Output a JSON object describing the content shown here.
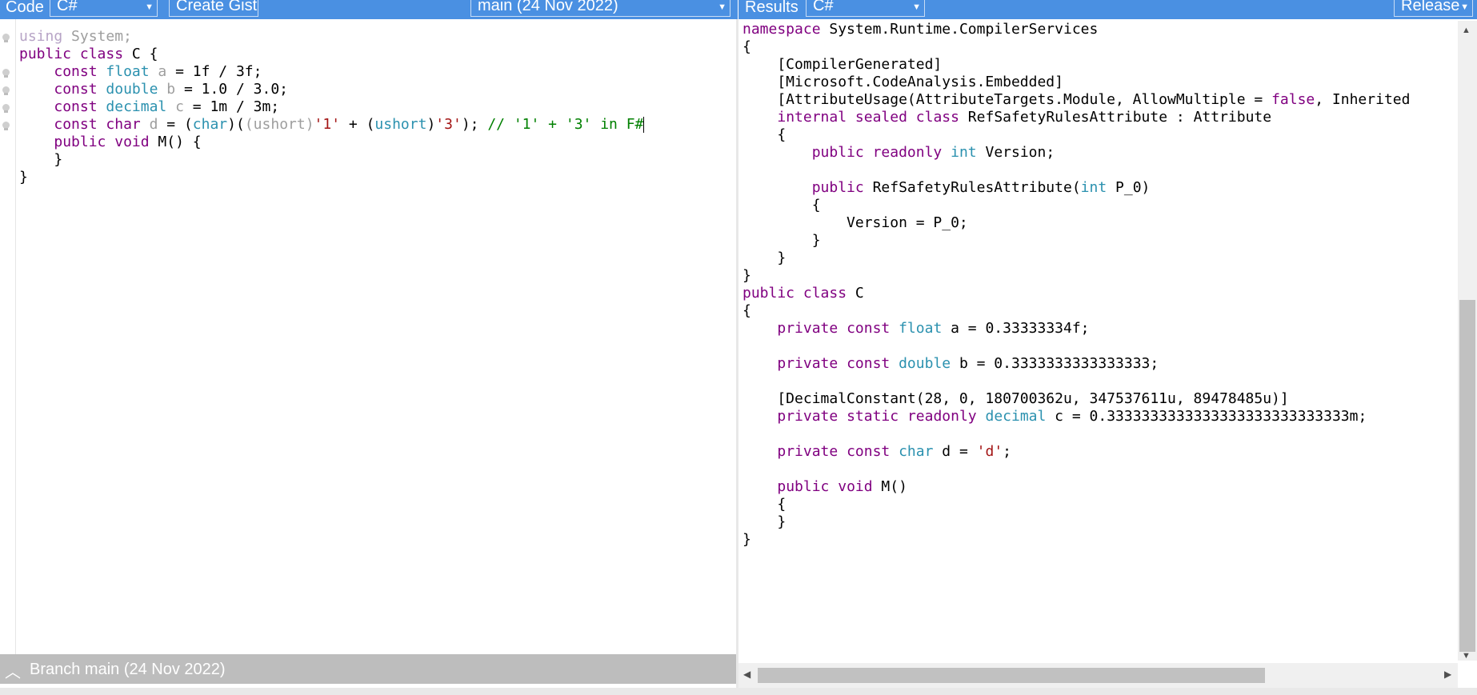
{
  "left_toolbar": {
    "code_label": "Code",
    "language_select": "C#",
    "create_gist_label": "Create Gist",
    "branch_select": "main (24 Nov 2022)"
  },
  "right_toolbar": {
    "results_label": "Results",
    "language_select": "C#",
    "config_select": "Release"
  },
  "status_bar": {
    "branch_label": "Branch main (24 Nov 2022)"
  },
  "code_lines": [
    [
      {
        "t": "using",
        "c": "dim2"
      },
      {
        "t": " System;",
        "c": "dim"
      }
    ],
    [
      {
        "t": "public",
        "c": "k"
      },
      {
        "t": " "
      },
      {
        "t": "class",
        "c": "k"
      },
      {
        "t": " C {"
      }
    ],
    [
      {
        "t": "    "
      },
      {
        "t": "const",
        "c": "k"
      },
      {
        "t": " "
      },
      {
        "t": "float",
        "c": "t"
      },
      {
        "t": " "
      },
      {
        "t": "a",
        "c": "dim"
      },
      {
        "t": " = 1f / 3f;"
      }
    ],
    [
      {
        "t": "    "
      },
      {
        "t": "const",
        "c": "k"
      },
      {
        "t": " "
      },
      {
        "t": "double",
        "c": "t"
      },
      {
        "t": " "
      },
      {
        "t": "b",
        "c": "dim"
      },
      {
        "t": " = 1.0 / 3.0;"
      }
    ],
    [
      {
        "t": "    "
      },
      {
        "t": "const",
        "c": "k"
      },
      {
        "t": " "
      },
      {
        "t": "decimal",
        "c": "t"
      },
      {
        "t": " "
      },
      {
        "t": "c",
        "c": "dim"
      },
      {
        "t": " = 1m / 3m;"
      }
    ],
    [
      {
        "t": "    "
      },
      {
        "t": "const",
        "c": "k"
      },
      {
        "t": " "
      },
      {
        "t": "char",
        "c": "k"
      },
      {
        "t": " "
      },
      {
        "t": "d",
        "c": "dim"
      },
      {
        "t": " = ("
      },
      {
        "t": "char",
        "c": "t"
      },
      {
        "t": ")("
      },
      {
        "t": "(ushort)",
        "c": "dim"
      },
      {
        "t": "'1'",
        "c": "s"
      },
      {
        "t": " + ("
      },
      {
        "t": "ushort",
        "c": "t"
      },
      {
        "t": ")"
      },
      {
        "t": "'3'",
        "c": "s"
      },
      {
        "t": "); "
      },
      {
        "t": "// '1' + '3' in F#",
        "c": "c"
      }
    ],
    [
      {
        "t": "    "
      },
      {
        "t": "public",
        "c": "k"
      },
      {
        "t": " "
      },
      {
        "t": "void",
        "c": "k"
      },
      {
        "t": " M() {"
      }
    ],
    [
      {
        "t": "    }"
      }
    ],
    [
      {
        "t": "}"
      }
    ]
  ],
  "result_lines": [
    [
      {
        "t": "namespace",
        "c": "k"
      },
      {
        "t": " System.Runtime.CompilerServices"
      }
    ],
    [
      {
        "t": "{"
      }
    ],
    [
      {
        "t": "    [CompilerGenerated]"
      }
    ],
    [
      {
        "t": "    [Microsoft.CodeAnalysis.Embedded]"
      }
    ],
    [
      {
        "t": "    [AttributeUsage(AttributeTargets.Module, AllowMultiple = "
      },
      {
        "t": "false",
        "c": "k"
      },
      {
        "t": ", Inherited"
      }
    ],
    [
      {
        "t": "    "
      },
      {
        "t": "internal",
        "c": "k"
      },
      {
        "t": " "
      },
      {
        "t": "sealed",
        "c": "k"
      },
      {
        "t": " "
      },
      {
        "t": "class",
        "c": "k"
      },
      {
        "t": " RefSafetyRulesAttribute : Attribute"
      }
    ],
    [
      {
        "t": "    {"
      }
    ],
    [
      {
        "t": "        "
      },
      {
        "t": "public",
        "c": "k"
      },
      {
        "t": " "
      },
      {
        "t": "readonly",
        "c": "k"
      },
      {
        "t": " "
      },
      {
        "t": "int",
        "c": "t"
      },
      {
        "t": " Version;"
      }
    ],
    [
      {
        "t": ""
      }
    ],
    [
      {
        "t": "        "
      },
      {
        "t": "public",
        "c": "k"
      },
      {
        "t": " RefSafetyRulesAttribute("
      },
      {
        "t": "int",
        "c": "t"
      },
      {
        "t": " P_0)"
      }
    ],
    [
      {
        "t": "        {"
      }
    ],
    [
      {
        "t": "            Version = P_0;"
      }
    ],
    [
      {
        "t": "        }"
      }
    ],
    [
      {
        "t": "    }"
      }
    ],
    [
      {
        "t": "}"
      }
    ],
    [
      {
        "t": "public",
        "c": "k"
      },
      {
        "t": " "
      },
      {
        "t": "class",
        "c": "k"
      },
      {
        "t": " C"
      }
    ],
    [
      {
        "t": "{"
      }
    ],
    [
      {
        "t": "    "
      },
      {
        "t": "private",
        "c": "k"
      },
      {
        "t": " "
      },
      {
        "t": "const",
        "c": "k"
      },
      {
        "t": " "
      },
      {
        "t": "float",
        "c": "t"
      },
      {
        "t": " a = 0.33333334f;"
      }
    ],
    [
      {
        "t": ""
      }
    ],
    [
      {
        "t": "    "
      },
      {
        "t": "private",
        "c": "k"
      },
      {
        "t": " "
      },
      {
        "t": "const",
        "c": "k"
      },
      {
        "t": " "
      },
      {
        "t": "double",
        "c": "t"
      },
      {
        "t": " b = 0.3333333333333333;"
      }
    ],
    [
      {
        "t": ""
      }
    ],
    [
      {
        "t": "    [DecimalConstant(28, 0, 180700362u, 347537611u, 89478485u)]"
      }
    ],
    [
      {
        "t": "    "
      },
      {
        "t": "private",
        "c": "k"
      },
      {
        "t": " "
      },
      {
        "t": "static",
        "c": "k"
      },
      {
        "t": " "
      },
      {
        "t": "readonly",
        "c": "k"
      },
      {
        "t": " "
      },
      {
        "t": "decimal",
        "c": "t"
      },
      {
        "t": " c = 0.3333333333333333333333333333m;"
      }
    ],
    [
      {
        "t": ""
      }
    ],
    [
      {
        "t": "    "
      },
      {
        "t": "private",
        "c": "k"
      },
      {
        "t": " "
      },
      {
        "t": "const",
        "c": "k"
      },
      {
        "t": " "
      },
      {
        "t": "char",
        "c": "t"
      },
      {
        "t": " d = "
      },
      {
        "t": "'d'",
        "c": "s"
      },
      {
        "t": ";"
      }
    ],
    [
      {
        "t": ""
      }
    ],
    [
      {
        "t": "    "
      },
      {
        "t": "public",
        "c": "k"
      },
      {
        "t": " "
      },
      {
        "t": "void",
        "c": "k"
      },
      {
        "t": " M()"
      }
    ],
    [
      {
        "t": "    {"
      }
    ],
    [
      {
        "t": "    }"
      }
    ],
    [
      {
        "t": "}"
      }
    ]
  ],
  "colors": {
    "toolbar": "#4a90e2",
    "keyword": "#800080",
    "type": "#2b91af",
    "string": "#a31515",
    "comment": "#008000"
  },
  "icons": {
    "gutter": "lightbulb-icon",
    "branch_toggle": "chevron-up-icon",
    "dropdown": "chevron-down-icon"
  }
}
